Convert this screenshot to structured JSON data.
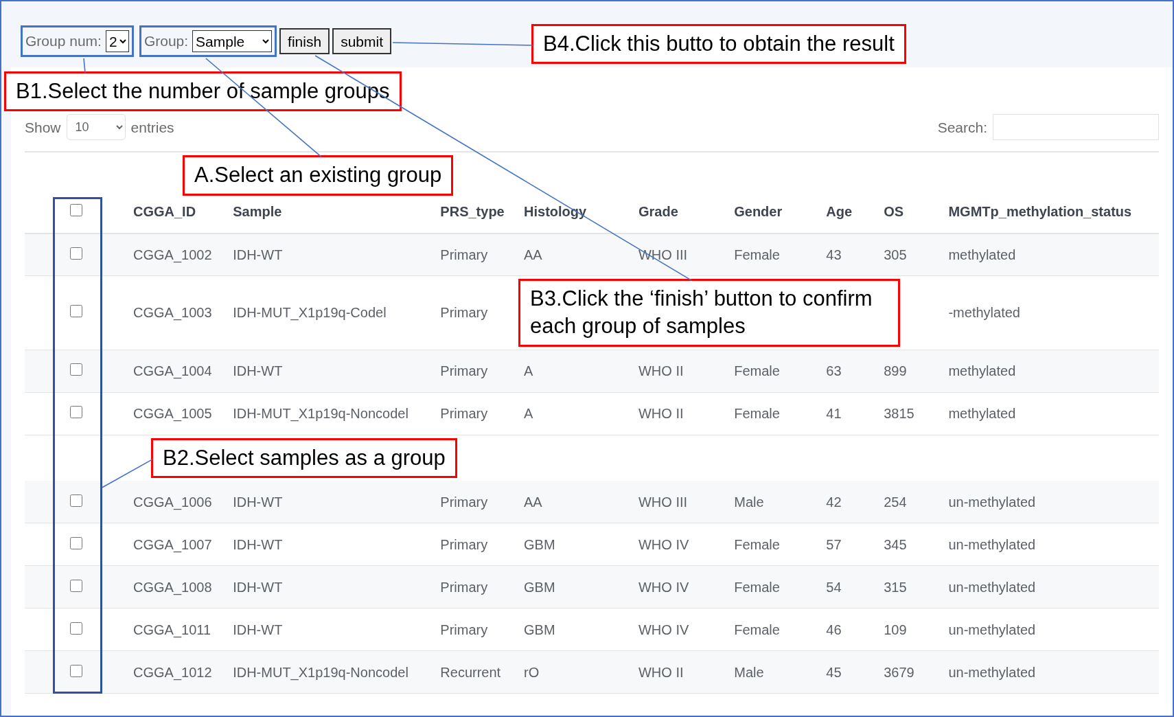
{
  "toolbar": {
    "group_num": {
      "label": "Group num:",
      "value": "2"
    },
    "group": {
      "label": "Group:",
      "value": "Sample"
    },
    "buttons": [
      "finish",
      "submit"
    ],
    "callout": "B4.Click this butto to obtain the result"
  },
  "settings_callout": "B1.Select the number of sample groups",
  "length_menu": {
    "label_before": "Show",
    "value": "10",
    "label_after": "entries"
  },
  "search": {
    "label": "Search:"
  },
  "table": {
    "header_checked": false,
    "header_callout": "A.Select an existing group",
    "columns": [
      "CGGA_ID",
      "Sample",
      "PRS_type",
      "Histology",
      "Grade",
      "Gender",
      "Age",
      "OS",
      "MGMTp_methylation_status"
    ],
    "rows": [
      {
        "kind": "data",
        "checked": false,
        "cells": [
          "CGGA_1002",
          "IDH-WT",
          "Primary",
          "AA",
          "WHO III",
          "Female",
          "43",
          "305",
          "methylated"
        ]
      },
      {
        "kind": "data",
        "checked": false,
        "cells": [
          "CGGA_1003",
          "IDH-MUT_X1p19q-Codel",
          "Primary",
          null,
          null,
          null,
          null,
          null,
          "-methylated"
        ],
        "callout": "B3.Click the ‘finish’ button to confirm each group of samples"
      },
      {
        "kind": "data",
        "checked": false,
        "cells": [
          "CGGA_1004",
          "IDH-WT",
          "Primary",
          "A",
          "WHO II",
          "Female",
          "63",
          "899",
          "methylated"
        ]
      },
      {
        "kind": "data",
        "checked": false,
        "cells": [
          "CGGA_1005",
          "IDH-MUT_X1p19q-Noncodel",
          "Primary",
          "A",
          "WHO II",
          "Female",
          "41",
          "3815",
          "methylated"
        ]
      },
      {
        "kind": "callout",
        "text": "B2.Select samples as a group"
      },
      {
        "kind": "data",
        "checked": false,
        "cells": [
          "CGGA_1006",
          "IDH-WT",
          "Primary",
          "AA",
          "WHO III",
          "Male",
          "42",
          "254",
          "un-methylated"
        ]
      },
      {
        "kind": "data",
        "checked": false,
        "cells": [
          "CGGA_1007",
          "IDH-WT",
          "Primary",
          "GBM",
          "WHO IV",
          "Female",
          "57",
          "345",
          "un-methylated"
        ]
      },
      {
        "kind": "data",
        "checked": false,
        "cells": [
          "CGGA_1008",
          "IDH-WT",
          "Primary",
          "GBM",
          "WHO IV",
          "Female",
          "54",
          "315",
          "un-methylated"
        ]
      },
      {
        "kind": "data",
        "checked": false,
        "cells": [
          "CGGA_1011",
          "IDH-WT",
          "Primary",
          "GBM",
          "WHO IV",
          "Female",
          "46",
          "109",
          "un-methylated"
        ]
      },
      {
        "kind": "data",
        "checked": false,
        "cells": [
          "CGGA_1012",
          "IDH-MUT_X1p19q-Noncodel",
          "Recurrent",
          "rO",
          "WHO II",
          "Male",
          "45",
          "3679",
          "un-methylated"
        ]
      }
    ]
  }
}
